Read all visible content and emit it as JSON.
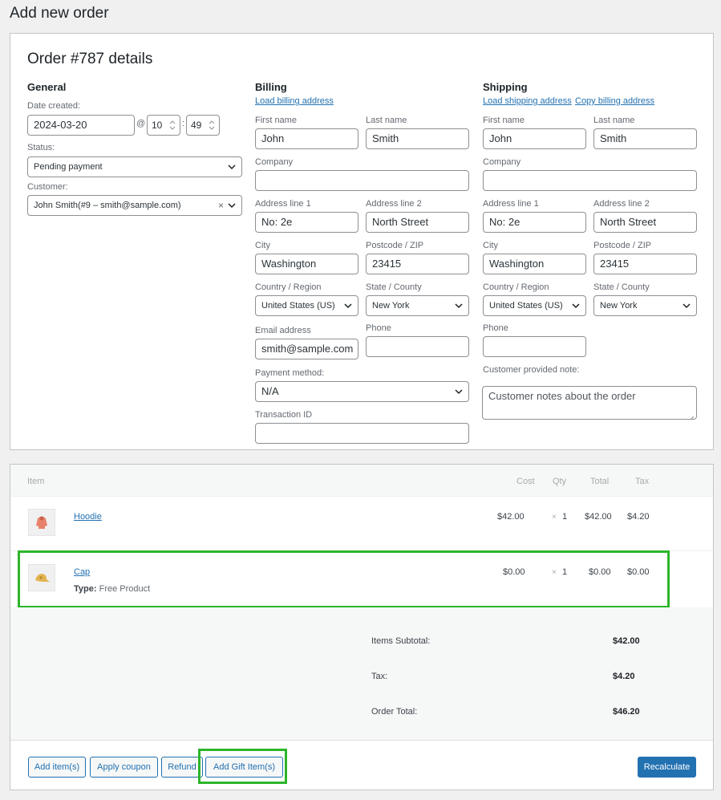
{
  "page": {
    "title": "Add new order"
  },
  "order": {
    "heading": "Order #787 details",
    "general": {
      "title": "General",
      "date_label": "Date created:",
      "date_value": "2024-03-20",
      "at_sign": "@",
      "hour_value": "10",
      "time_separator": ":",
      "minute_value": "49",
      "status_label": "Status:",
      "status_value": "Pending payment",
      "customer_label": "Customer:",
      "customer_value": "John Smith(#9 – smith@sample.com)",
      "clear_glyph": "×"
    },
    "billing": {
      "title": "Billing",
      "load_link": "Load billing address",
      "first_name_label": "First name",
      "first_name": "John",
      "last_name_label": "Last name",
      "last_name": "Smith",
      "company_label": "Company",
      "company": "",
      "address1_label": "Address line 1",
      "address1": "No: 2e",
      "address2_label": "Address line 2",
      "address2": "North Street",
      "city_label": "City",
      "city": "Washington",
      "postcode_label": "Postcode / ZIP",
      "postcode": "23415",
      "country_label": "Country / Region",
      "country": "United States (US)",
      "state_label": "State / County",
      "state": "New York",
      "email_label": "Email address",
      "email": "smith@sample.com",
      "phone_label": "Phone",
      "phone": "",
      "payment_label": "Payment method:",
      "payment": "N/A",
      "transaction_label": "Transaction ID",
      "transaction": ""
    },
    "shipping": {
      "title": "Shipping",
      "load_link": "Load shipping address",
      "copy_link": "Copy billing address",
      "first_name_label": "First name",
      "first_name": "John",
      "last_name_label": "Last name",
      "last_name": "Smith",
      "company_label": "Company",
      "company": "",
      "address1_label": "Address line 1",
      "address1": "No: 2e",
      "address2_label": "Address line 2",
      "address2": "North Street",
      "city_label": "City",
      "city": "Washington",
      "postcode_label": "Postcode / ZIP",
      "postcode": "23415",
      "country_label": "Country / Region",
      "country": "United States (US)",
      "state_label": "State / County",
      "state": "New York",
      "phone_label": "Phone",
      "phone": "",
      "note_label": "Customer provided note:",
      "note_placeholder": "Customer notes about the order"
    }
  },
  "items": {
    "headers": {
      "item": "Item",
      "cost": "Cost",
      "qty": "Qty",
      "total": "Total",
      "tax": "Tax"
    },
    "rows": [
      {
        "name": "Hoodie",
        "cost": "$42.00",
        "qty_sign": "×",
        "qty": "1",
        "total": "$42.00",
        "tax": "$4.20",
        "icon": "hoodie-icon"
      },
      {
        "name": "Cap",
        "meta_label": "Type:",
        "meta_value": "Free Product",
        "cost": "$0.00",
        "qty_sign": "×",
        "qty": "1",
        "total": "$0.00",
        "tax": "$0.00",
        "icon": "cap-icon"
      }
    ],
    "totals": {
      "subtotal_label": "Items Subtotal:",
      "subtotal_value": "$42.00",
      "tax_label": "Tax:",
      "tax_value": "$4.20",
      "total_label": "Order Total:",
      "total_value": "$46.20"
    },
    "buttons": {
      "add_items": "Add item(s)",
      "apply_coupon": "Apply coupon",
      "refund": "Refund",
      "add_gift": "Add Gift Item(s)",
      "recalculate": "Recalculate"
    }
  },
  "colors": {
    "accent": "#2271b1",
    "highlight": "#2db52a"
  }
}
